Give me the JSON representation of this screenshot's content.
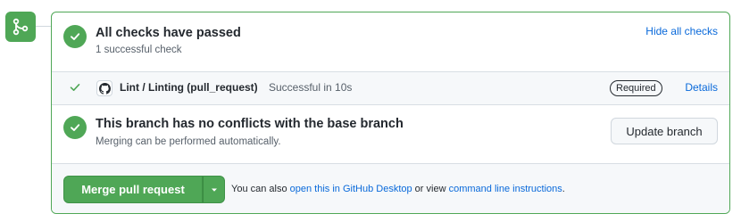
{
  "colors": {
    "success": "#4fa756",
    "link": "#0969da",
    "muted": "#57606a",
    "border": "#d0d7de"
  },
  "icons": {
    "side": "git-merge-icon",
    "ok": "check-circle-icon",
    "row_ok": "check-icon",
    "app": "github-icon",
    "caret": "triangle-down-icon"
  },
  "checks": {
    "title": "All checks have passed",
    "subtitle": "1 successful check",
    "toggle_label": "Hide all checks",
    "items": [
      {
        "name": "Lint / Linting (pull_request)",
        "status": "Successful in 10s",
        "badge": "Required",
        "details": "Details"
      }
    ]
  },
  "conflicts": {
    "title": "This branch has no conflicts with the base branch",
    "subtitle": "Merging can be performed automatically.",
    "update_button": "Update branch"
  },
  "merge": {
    "button": "Merge pull request",
    "note_prefix": "You can also ",
    "desktop_link": "open this in GitHub Desktop",
    "note_middle": " or view ",
    "cli_link": "command line instructions",
    "note_suffix": "."
  }
}
